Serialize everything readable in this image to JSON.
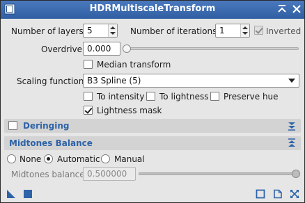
{
  "window": {
    "title": "HDRMultiscaleTransform",
    "colors": {
      "titlebar": "#3a6ab0",
      "accent": "#2e63a8",
      "background": "#e6e6e6"
    }
  },
  "params": {
    "layers_label": "Number of layers:",
    "layers_value": "5",
    "iterations_label": "Number of iterations:",
    "iterations_value": "1",
    "inverted_label": "Inverted",
    "inverted_checked": true,
    "overdrive_label": "Overdrive:",
    "overdrive_value": "0.000",
    "overdrive_slider_fraction": 0.0,
    "median_label": "Median transform",
    "median_checked": false,
    "scaling_label": "Scaling function:",
    "scaling_value": "B3 Spline (5)",
    "to_intensity_label": "To intensity",
    "to_lightness_label": "To lightness",
    "preserve_hue_label": "Preserve hue",
    "lightness_mask_label": "Lightness mask",
    "lightness_mask_checked": true
  },
  "deringing": {
    "title": "Deringing",
    "enabled": false
  },
  "midtones": {
    "title": "Midtones Balance",
    "options": [
      "None",
      "Automatic",
      "Manual"
    ],
    "selected": "Automatic",
    "balance_label": "Midtones balance:",
    "balance_value": "0.500000",
    "balance_slider_fraction": 1.0
  },
  "icons": {
    "titlebar": [
      "shade-icon",
      "collapse-icon",
      "close-icon"
    ],
    "bottom_left": [
      "new-instance-icon",
      "apply-icon"
    ],
    "bottom_right": [
      "preview-icon",
      "reset-icon",
      "expand-icon"
    ]
  }
}
